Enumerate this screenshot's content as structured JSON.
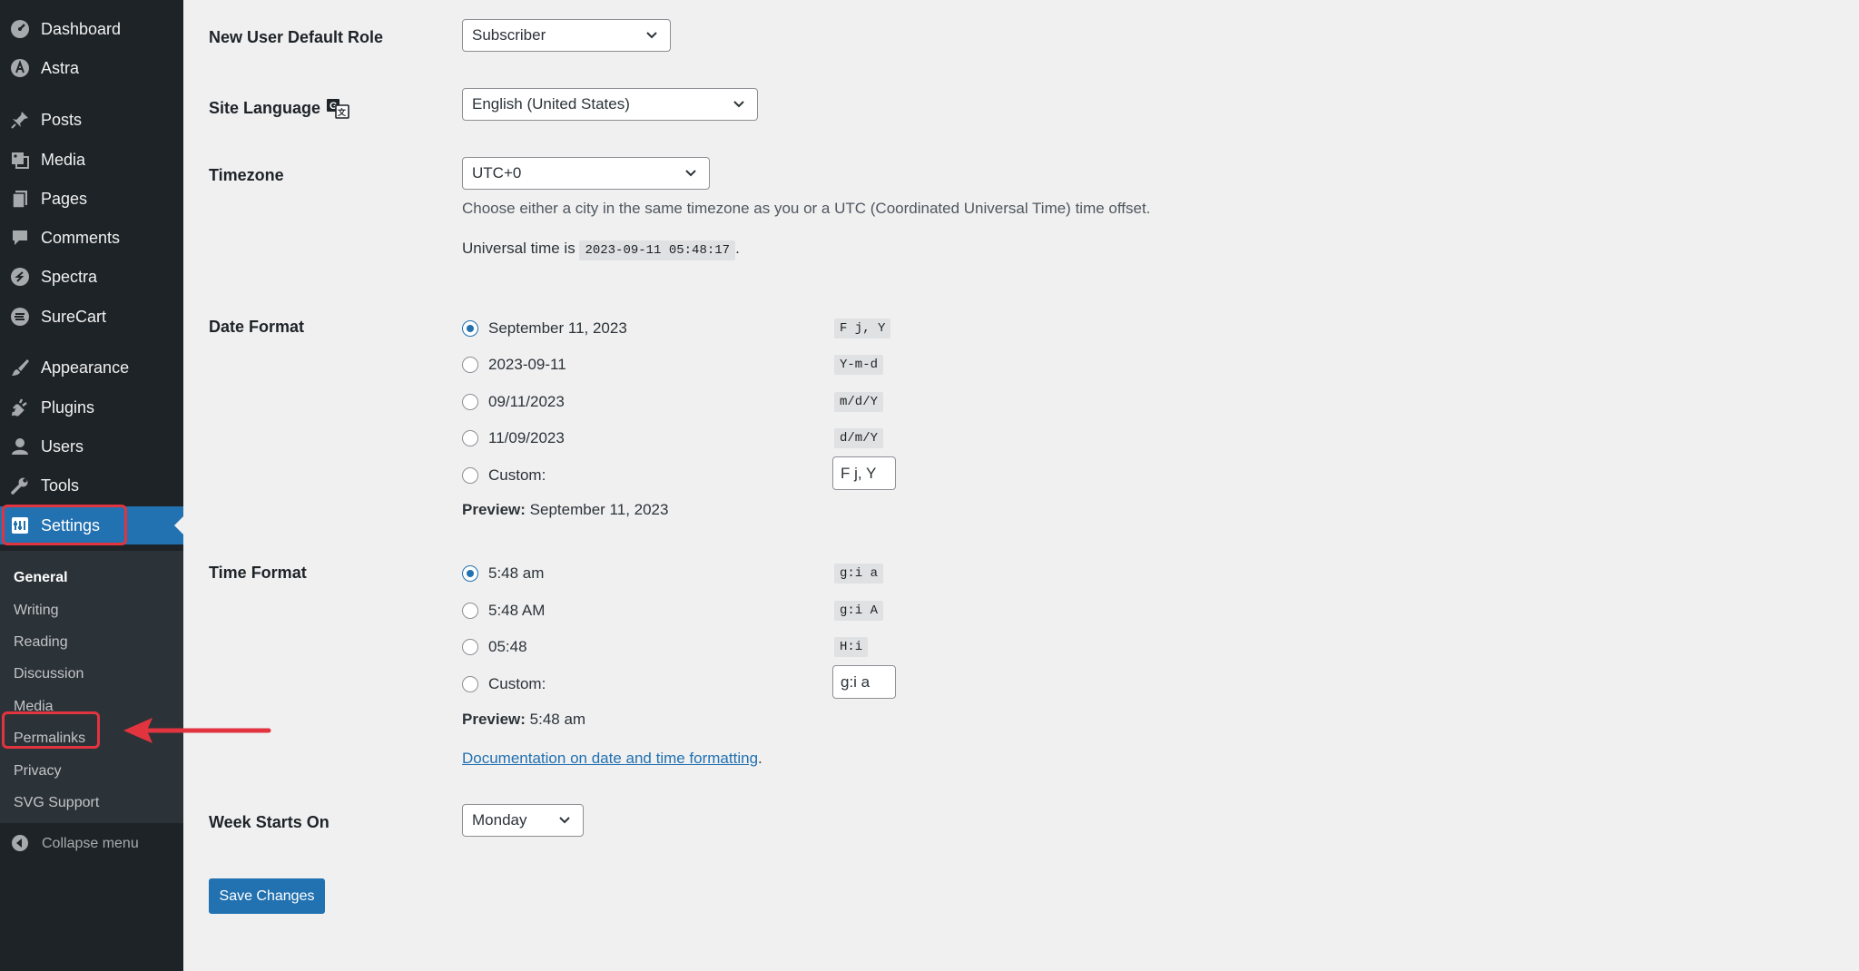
{
  "sidebar": {
    "items": [
      {
        "label": "Dashboard",
        "icon": "dashboard-icon"
      },
      {
        "label": "Astra",
        "icon": "astra-icon"
      },
      {
        "label": "Posts",
        "icon": "pin-icon"
      },
      {
        "label": "Media",
        "icon": "media-icon"
      },
      {
        "label": "Pages",
        "icon": "pages-icon"
      },
      {
        "label": "Comments",
        "icon": "comment-icon"
      },
      {
        "label": "Spectra",
        "icon": "spectra-icon"
      },
      {
        "label": "SureCart",
        "icon": "surecart-icon"
      },
      {
        "label": "Appearance",
        "icon": "brush-icon"
      },
      {
        "label": "Plugins",
        "icon": "plugin-icon"
      },
      {
        "label": "Users",
        "icon": "user-icon"
      },
      {
        "label": "Tools",
        "icon": "wrench-icon"
      },
      {
        "label": "Settings",
        "icon": "settings-icon"
      }
    ],
    "submenu": [
      "General",
      "Writing",
      "Reading",
      "Discussion",
      "Media",
      "Permalinks",
      "Privacy",
      "SVG Support"
    ],
    "collapse_label": "Collapse menu"
  },
  "form": {
    "default_role": {
      "label": "New User Default Role",
      "value": "Subscriber"
    },
    "site_language": {
      "label": "Site Language",
      "value": "English (United States)"
    },
    "timezone": {
      "label": "Timezone",
      "value": "UTC+0",
      "description": "Choose either a city in the same timezone as you or a UTC (Coordinated Universal Time) time offset.",
      "universal_prefix": "Universal time is",
      "universal_time": "2023-09-11 05:48:17",
      "universal_suffix": "."
    },
    "date_format": {
      "label": "Date Format",
      "options": [
        {
          "label": "September 11, 2023",
          "code": "F j, Y",
          "checked": true
        },
        {
          "label": "2023-09-11",
          "code": "Y-m-d",
          "checked": false
        },
        {
          "label": "09/11/2023",
          "code": "m/d/Y",
          "checked": false
        },
        {
          "label": "11/09/2023",
          "code": "d/m/Y",
          "checked": false
        }
      ],
      "custom_label": "Custom:",
      "custom_value": "F j, Y",
      "preview_label": "Preview:",
      "preview_value": "September 11, 2023"
    },
    "time_format": {
      "label": "Time Format",
      "options": [
        {
          "label": "5:48 am",
          "code": "g:i a",
          "checked": true
        },
        {
          "label": "5:48 AM",
          "code": "g:i A",
          "checked": false
        },
        {
          "label": "05:48",
          "code": "H:i",
          "checked": false
        }
      ],
      "custom_label": "Custom:",
      "custom_value": "g:i a",
      "preview_label": "Preview:",
      "preview_value": "5:48 am"
    },
    "doc_link": "Documentation on date and time formatting",
    "doc_suffix": ".",
    "week_starts": {
      "label": "Week Starts On",
      "value": "Monday"
    },
    "save_label": "Save Changes"
  },
  "colors": {
    "accent": "#2271b1",
    "highlight": "#e2343f",
    "sidebar": "#1d2327"
  }
}
